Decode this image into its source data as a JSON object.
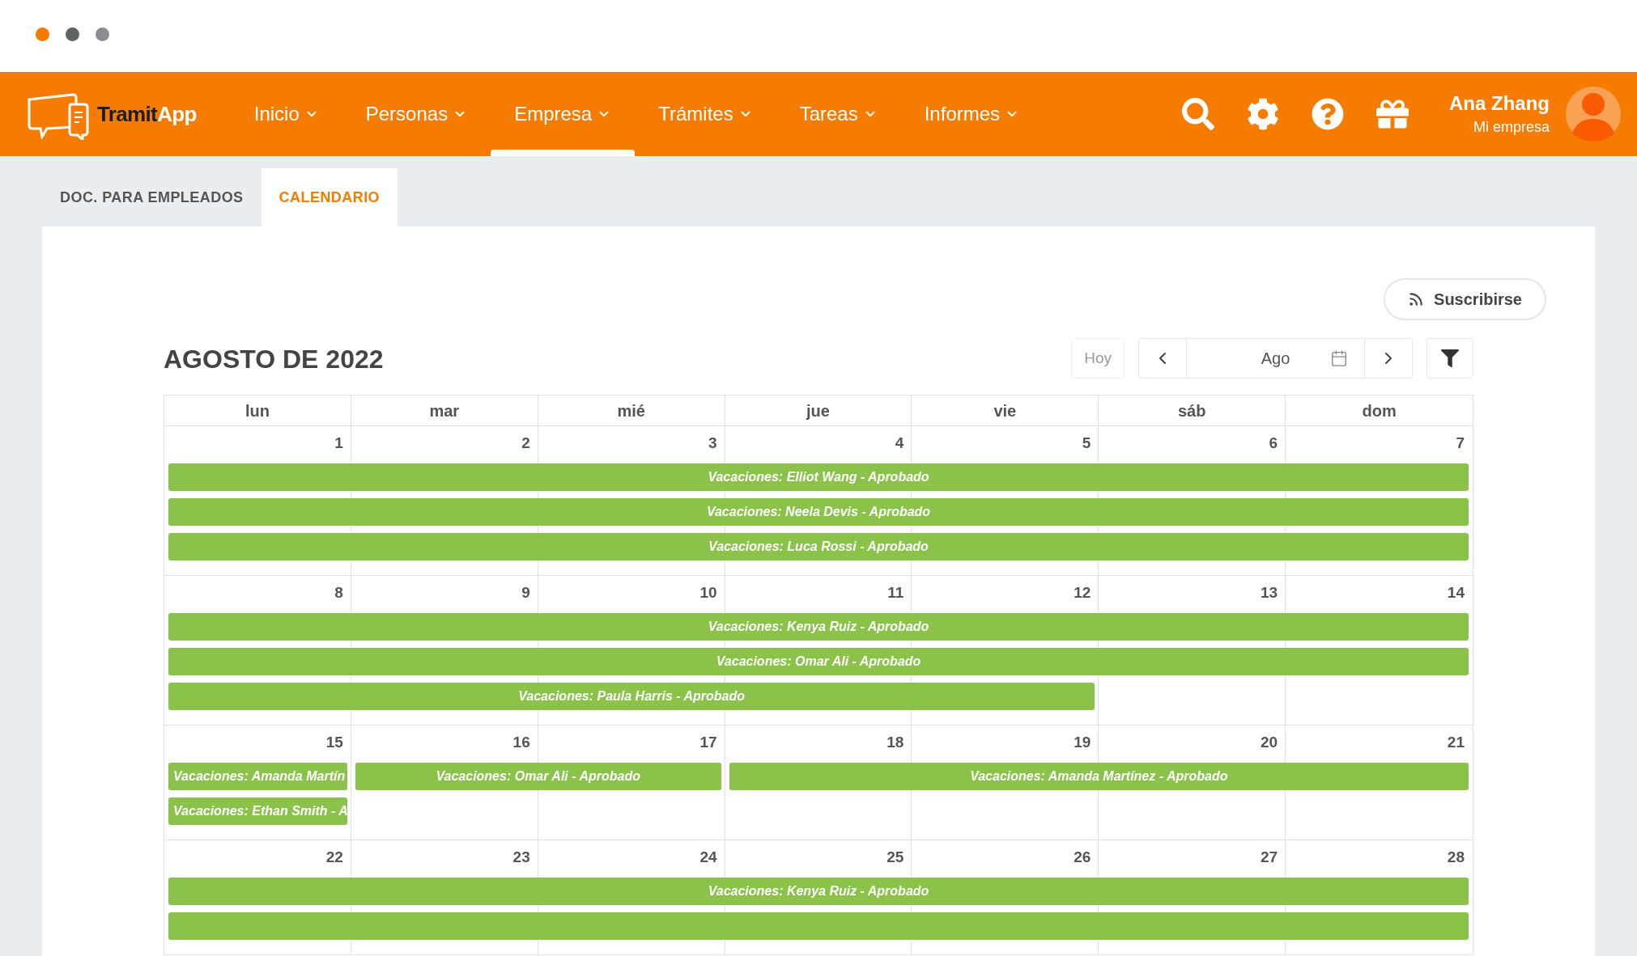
{
  "window_controls": [
    {
      "color": "#f47b00"
    },
    {
      "color": "#5f6368"
    },
    {
      "color": "#8a8d91"
    }
  ],
  "brand": {
    "part1": "Tramit",
    "part2": "App"
  },
  "nav": [
    {
      "label": "Inicio",
      "selected": false
    },
    {
      "label": "Personas",
      "selected": false
    },
    {
      "label": "Empresa",
      "selected": true
    },
    {
      "label": "Trámites",
      "selected": false
    },
    {
      "label": "Tareas",
      "selected": false
    },
    {
      "label": "Informes",
      "selected": false
    }
  ],
  "user": {
    "name": "Ana Zhang",
    "company": "Mi empresa"
  },
  "tabs": [
    {
      "label": "DOC. PARA EMPLEADOS",
      "selected": false
    },
    {
      "label": "CALENDARIO",
      "selected": true
    }
  ],
  "subscribe_button": "Suscribirse",
  "calendar": {
    "title": "AGOSTO DE 2022",
    "today_button": "Hoy",
    "month_field": "Ago",
    "weekdays": [
      "lun",
      "mar",
      "mié",
      "jue",
      "vie",
      "sáb",
      "dom"
    ],
    "weeks": [
      {
        "days": [
          "1",
          "2",
          "3",
          "4",
          "5",
          "6",
          "7"
        ],
        "lanes": [
          [
            {
              "kind": "event",
              "label": "Vacaciones: Elliot Wang - Aprobado"
            },
            {
              "kind": "continued"
            },
            {
              "kind": "continued"
            },
            {
              "kind": "continued"
            },
            {
              "kind": "continued"
            },
            {
              "kind": "continued"
            },
            {
              "kind": "continued"
            }
          ],
          [
            {
              "kind": "event",
              "label": "Vacaciones: Neela Devis - Aprobado"
            },
            {
              "kind": "continued"
            },
            {
              "kind": "continued"
            },
            {
              "kind": "continued"
            },
            {
              "kind": "continued"
            },
            {
              "kind": "continued"
            },
            {
              "kind": "continued"
            }
          ],
          [
            {
              "kind": "event",
              "label": "Vacaciones: Luca Rossi - Aprobado"
            },
            {
              "kind": "continued"
            },
            {
              "kind": "continued"
            },
            {
              "kind": "continued"
            },
            {
              "kind": "continued"
            },
            {
              "kind": "continued"
            },
            {
              "kind": "continued"
            }
          ]
        ]
      },
      {
        "days": [
          "8",
          "9",
          "10",
          "11",
          "12",
          "13",
          "14"
        ],
        "lanes": [
          [
            {
              "kind": "event",
              "label": "Vacaciones: Kenya Ruiz - Aprobado"
            },
            {
              "kind": "continued"
            },
            {
              "kind": "continued"
            },
            {
              "kind": "continued"
            },
            {
              "kind": "continued"
            },
            {
              "kind": "continued"
            },
            {
              "kind": "continued"
            }
          ],
          [
            {
              "kind": "event",
              "label": "Vacaciones: Omar Ali - Aprobado"
            },
            {
              "kind": "continued"
            },
            {
              "kind": "continued"
            },
            {
              "kind": "continued"
            },
            {
              "kind": "continued"
            },
            {
              "kind": "continued"
            },
            {
              "kind": "continued"
            }
          ],
          [
            {
              "kind": "event",
              "label": "Vacaciones: Paula Harris - Aprobado"
            },
            {
              "kind": "continued"
            },
            {
              "kind": "continued"
            },
            {
              "kind": "continued"
            },
            {
              "kind": "continued"
            },
            {
              "kind": "empty"
            },
            {
              "kind": "empty"
            }
          ]
        ]
      },
      {
        "days": [
          "15",
          "16",
          "17",
          "18",
          "19",
          "20",
          "21"
        ],
        "lanes": [
          [
            {
              "kind": "event",
              "label": "Vacaciones: Amanda Martín"
            },
            {
              "kind": "event",
              "label": "Vacaciones: Omar Ali - Aprobado"
            },
            {
              "kind": "continued"
            },
            {
              "kind": "event",
              "label": "Vacaciones: Amanda Martínez - Aprobado"
            },
            {
              "kind": "continued"
            },
            {
              "kind": "continued"
            },
            {
              "kind": "continued"
            }
          ],
          [
            {
              "kind": "event",
              "label": "Vacaciones: Ethan Smith - A"
            },
            {
              "kind": "empty"
            },
            {
              "kind": "empty"
            },
            {
              "kind": "empty"
            },
            {
              "kind": "empty"
            },
            {
              "kind": "empty"
            },
            {
              "kind": "empty"
            }
          ]
        ]
      },
      {
        "days": [
          "22",
          "23",
          "24",
          "25",
          "26",
          "27",
          "28"
        ],
        "lanes": [
          [
            {
              "kind": "event",
              "label": "Vacaciones: Kenya Ruiz - Aprobado"
            },
            {
              "kind": "continued"
            },
            {
              "kind": "continued"
            },
            {
              "kind": "continued"
            },
            {
              "kind": "continued"
            },
            {
              "kind": "continued"
            },
            {
              "kind": "continued"
            }
          ],
          [
            {
              "kind": "event"
            },
            {
              "kind": "continued"
            },
            {
              "kind": "continued"
            },
            {
              "kind": "continued"
            },
            {
              "kind": "continued"
            },
            {
              "kind": "continued"
            },
            {
              "kind": "continued"
            }
          ]
        ]
      }
    ]
  }
}
